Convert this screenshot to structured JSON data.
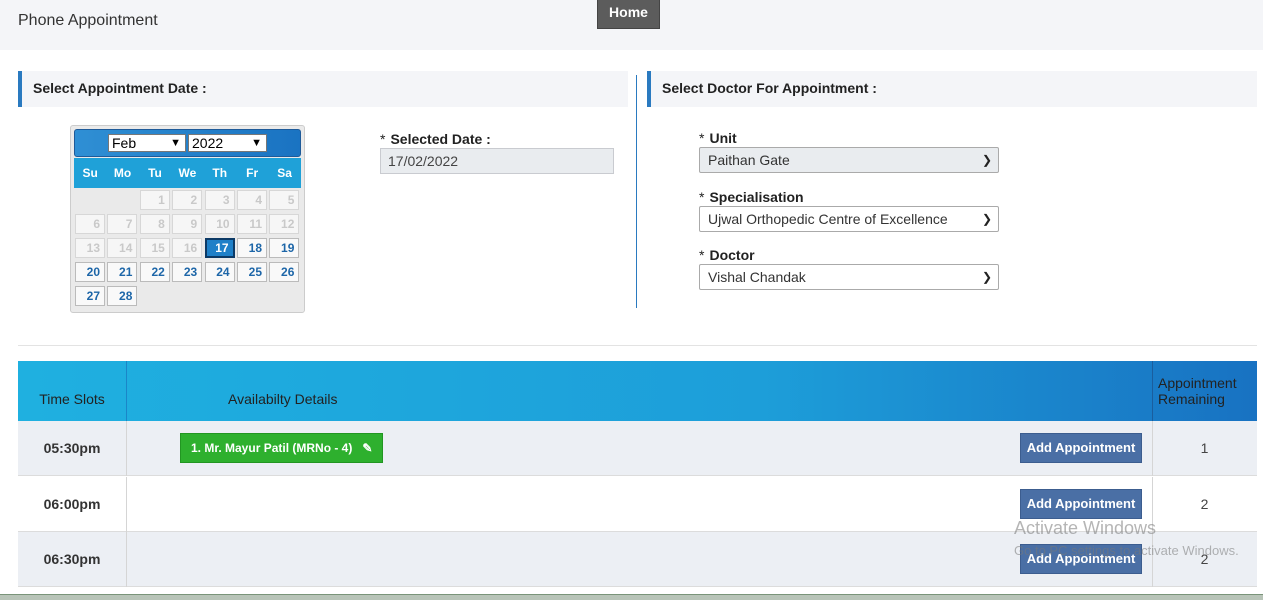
{
  "header": {
    "title": "Phone Appointment",
    "home_label": "Home"
  },
  "date_section": {
    "heading": "Select Appointment Date :"
  },
  "doctor_section": {
    "heading": "Select Doctor For Appointment :"
  },
  "calendar": {
    "month": "Feb",
    "year": "2022",
    "weekdays": [
      "Su",
      "Mo",
      "Tu",
      "We",
      "Th",
      "Fr",
      "Sa"
    ],
    "weeks": [
      [
        "",
        "",
        "1",
        "2",
        "3",
        "4",
        "5"
      ],
      [
        "6",
        "7",
        "8",
        "9",
        "10",
        "11",
        "12"
      ],
      [
        "13",
        "14",
        "15",
        "16",
        "17",
        "18",
        "19"
      ],
      [
        "20",
        "21",
        "22",
        "23",
        "24",
        "25",
        "26"
      ],
      [
        "27",
        "28",
        "",
        "",
        "",
        "",
        ""
      ]
    ],
    "selected_day": "17"
  },
  "selected_date": {
    "label": "Selected Date :",
    "value": "17/02/2022"
  },
  "unit": {
    "label": "Unit",
    "value": "Paithan Gate"
  },
  "specialisation": {
    "label": "Specialisation",
    "value": "Ujwal Orthopedic Centre of Excellence"
  },
  "doctor": {
    "label": "Doctor",
    "value": "Vishal Chandak"
  },
  "table": {
    "col_time": "Time Slots",
    "col_details": "Availabilty Details",
    "col_remaining": "Appointment Remaining",
    "rows": [
      {
        "time": "05:30pm",
        "booking": "1. Mr. Mayur Patil (MRNo - 4)",
        "button": "Add Appointment",
        "remaining": "1"
      },
      {
        "time": "06:00pm",
        "booking": "",
        "button": "Add Appointment",
        "remaining": "2"
      },
      {
        "time": "06:30pm",
        "booking": "",
        "button": "Add Appointment",
        "remaining": "2"
      }
    ]
  },
  "watermark": {
    "line1": "Activate Windows",
    "line2": "Go to PC settings to activate Windows."
  }
}
